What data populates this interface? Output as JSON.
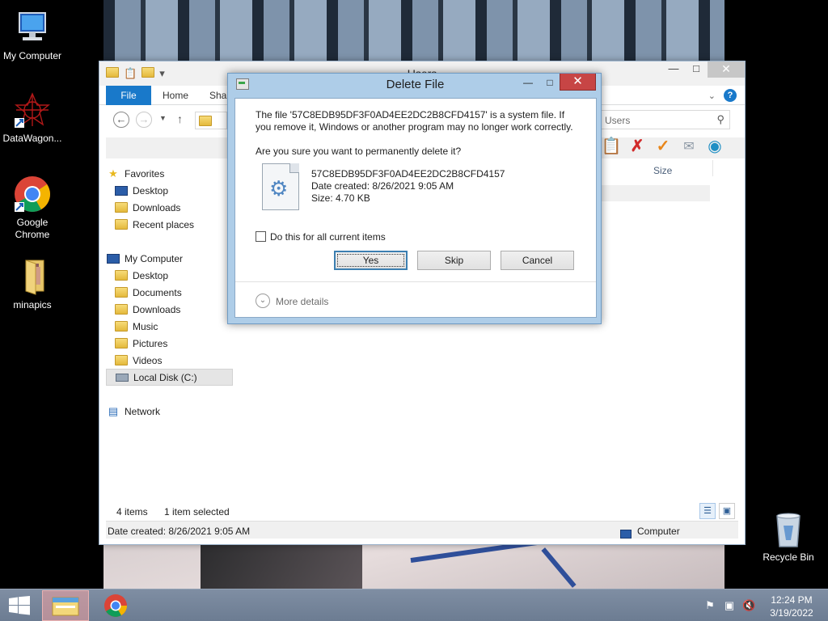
{
  "desktop": {
    "icons": [
      {
        "label": "My Computer",
        "icon": "computer-icon"
      },
      {
        "label": "DataWagon...",
        "icon": "datawagon-icon"
      },
      {
        "label": "Google Chrome",
        "icon": "chrome-icon"
      },
      {
        "label": "minapics",
        "icon": "folder-icon"
      },
      {
        "label": "Recycle Bin",
        "icon": "recycle-bin-icon"
      }
    ]
  },
  "explorer": {
    "title": "Users",
    "tabs": {
      "file": "File",
      "home": "Home",
      "share": "Shar"
    },
    "search_placeholder": "Users",
    "column_size": "Size",
    "nav": {
      "favorites": "Favorites",
      "fav_desktop": "Desktop",
      "fav_downloads": "Downloads",
      "fav_recent": "Recent places",
      "computer": "My Computer",
      "pc_desktop": "Desktop",
      "pc_documents": "Documents",
      "pc_downloads": "Downloads",
      "pc_music": "Music",
      "pc_pictures": "Pictures",
      "pc_videos": "Videos",
      "pc_localdisk": "Local Disk (C:)",
      "network": "Network"
    },
    "status": {
      "items": "4 items",
      "selected": "1 item selected"
    },
    "details": {
      "date": "Date created: 8/26/2021 9:05 AM",
      "location": "Computer"
    }
  },
  "dialog": {
    "title": "Delete File",
    "message": "The file '57C8EDB95DF3F0AD4EE2DC2B8CFD4157' is a system file. If you remove it, Windows or another program may no longer work correctly.",
    "question": "Are you sure you want to permanently delete it?",
    "file_name": "57C8EDB95DF3F0AD4EE2DC2B8CFD4157",
    "file_date": "Date created: 8/26/2021 9:05 AM",
    "file_size": "Size: 4.70 KB",
    "checkbox_label": "Do this for all current items",
    "buttons": {
      "yes": "Yes",
      "skip": "Skip",
      "cancel": "Cancel"
    },
    "more_details": "More details"
  },
  "taskbar": {
    "time": "12:24 PM",
    "date": "3/19/2022"
  }
}
